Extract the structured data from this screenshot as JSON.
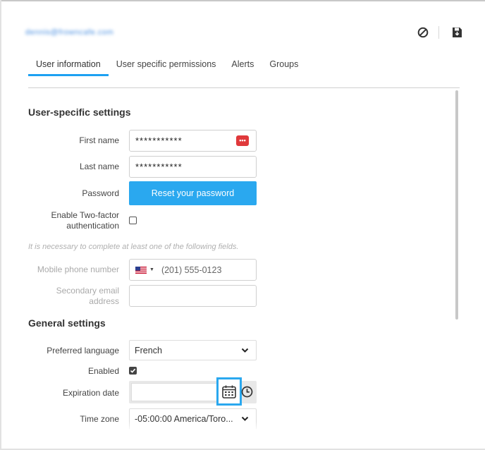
{
  "header": {
    "account": "dennis@frowncafe.com",
    "icons": {
      "cancel": "block-icon",
      "save": "save-icon"
    }
  },
  "tabs": [
    {
      "label": "User information",
      "active": true
    },
    {
      "label": "User specific permissions",
      "active": false
    },
    {
      "label": "Alerts",
      "active": false
    },
    {
      "label": "Groups",
      "active": false
    }
  ],
  "user_settings": {
    "title": "User-specific settings",
    "first_name": {
      "label": "First name",
      "value": "***********"
    },
    "last_name": {
      "label": "Last name",
      "value": "***********"
    },
    "password": {
      "label": "Password",
      "button": "Reset your password"
    },
    "two_factor": {
      "label_line1": "Enable Two-factor",
      "label_line2": "authentication",
      "checked": false
    },
    "hint": "It is necessary to complete at least one of the following fields.",
    "mobile_phone": {
      "label": "Mobile phone number",
      "placeholder": "(201) 555-0123",
      "country": "US"
    },
    "secondary_email": {
      "label_line1": "Secondary email",
      "label_line2": "address",
      "value": ""
    }
  },
  "general_settings": {
    "title": "General settings",
    "preferred_language": {
      "label": "Preferred language",
      "value": "French"
    },
    "enabled": {
      "label": "Enabled",
      "checked": true
    },
    "expiration_date": {
      "label": "Expiration date",
      "value": ""
    },
    "time_zone": {
      "label": "Time zone",
      "value": "-05:00:00 America/Toro..."
    }
  },
  "colors": {
    "accent": "#2aa8ef",
    "tab_underline": "#1da1f2",
    "danger": "#e0393b"
  }
}
